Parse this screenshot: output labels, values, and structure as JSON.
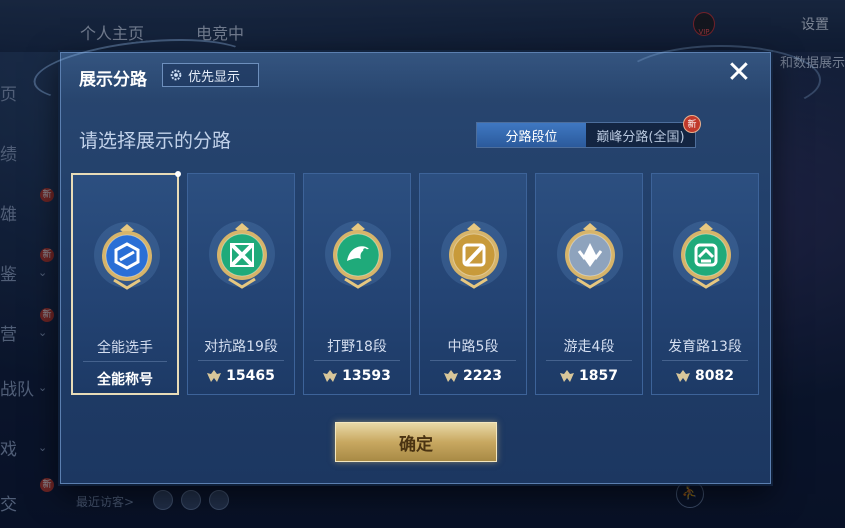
{
  "background": {
    "tabs": [
      "个人主页",
      "电竞中"
    ],
    "settings": "设置",
    "vip": "VIP",
    "right_text": "和数据展示",
    "left_nav": [
      {
        "label": "页",
        "new": false,
        "chevron": false
      },
      {
        "label": "绩",
        "new": false,
        "chevron": false
      },
      {
        "label": "雄",
        "new": true,
        "chevron": false
      },
      {
        "label": "鉴",
        "new": true,
        "chevron": true
      },
      {
        "label": "营",
        "new": true,
        "chevron": true
      },
      {
        "label": "战队",
        "new": false,
        "chevron": true
      },
      {
        "label": "戏",
        "new": false,
        "chevron": true
      },
      {
        "label": "交",
        "new": true,
        "chevron": false
      }
    ],
    "new_label": "新",
    "visitor_label": "最近访客>"
  },
  "modal": {
    "title": "展示分路",
    "priority_button": "优先显示",
    "close_icon": "✕",
    "prompt": "请选择展示的分路",
    "tabs": [
      {
        "label": "分路段位",
        "active": true
      },
      {
        "label": "巅峰分路(全国)",
        "active": false,
        "badge": "新"
      }
    ],
    "confirm": "确定"
  },
  "lanes": [
    {
      "title": "全能选手",
      "score": "全能称号",
      "emblem": "allround-emblem-icon",
      "color": "#2a6fd6",
      "selected": true,
      "has_rank_icon": false
    },
    {
      "title": "对抗路19段",
      "score": "15465",
      "emblem": "clash-lane-emblem-icon",
      "color": "#1faa7a",
      "selected": false,
      "has_rank_icon": true
    },
    {
      "title": "打野18段",
      "score": "13593",
      "emblem": "jungle-emblem-icon",
      "color": "#1faa7a",
      "selected": false,
      "has_rank_icon": true
    },
    {
      "title": "中路5段",
      "score": "2223",
      "emblem": "mid-lane-emblem-icon",
      "color": "#c89a3a",
      "selected": false,
      "has_rank_icon": true
    },
    {
      "title": "游走4段",
      "score": "1857",
      "emblem": "roam-emblem-icon",
      "color": "#8ea3bd",
      "selected": false,
      "has_rank_icon": true
    },
    {
      "title": "发育路13段",
      "score": "8082",
      "emblem": "farm-lane-emblem-icon",
      "color": "#1faa7a",
      "selected": false,
      "has_rank_icon": true
    }
  ]
}
